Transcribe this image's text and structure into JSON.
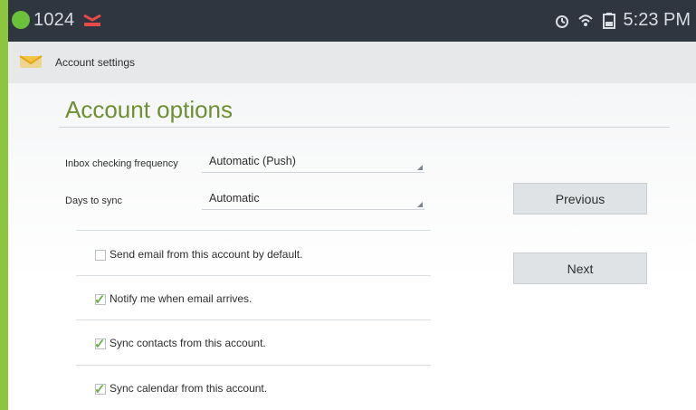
{
  "status_bar": {
    "left_text": "1024",
    "time": "5:23 PM",
    "icons": [
      "status-dot-icon",
      "alert-icon",
      "alarm-icon",
      "wifi-icon",
      "battery-icon"
    ]
  },
  "title_bar": {
    "title": "Account settings"
  },
  "main": {
    "heading": "Account options",
    "fields": [
      {
        "label": "Inbox checking frequency",
        "value": "Automatic (Push)"
      },
      {
        "label": "Days to sync",
        "value": "Automatic"
      }
    ],
    "checkboxes": [
      {
        "label": "Send email from this account by default.",
        "checked": false
      },
      {
        "label": "Notify me when email arrives.",
        "checked": true
      },
      {
        "label": "Sync contacts from this account.",
        "checked": true
      },
      {
        "label": "Sync calendar from this account.",
        "checked": true
      }
    ],
    "buttons": {
      "previous": "Previous",
      "next": "Next"
    }
  },
  "colors": {
    "accent_green": "#8cc63f",
    "heading_green": "#6e8f34",
    "status_bar_bg": "#2f3640",
    "title_bar_bg": "#e6e8ea",
    "check_green": "#6fb14d"
  }
}
